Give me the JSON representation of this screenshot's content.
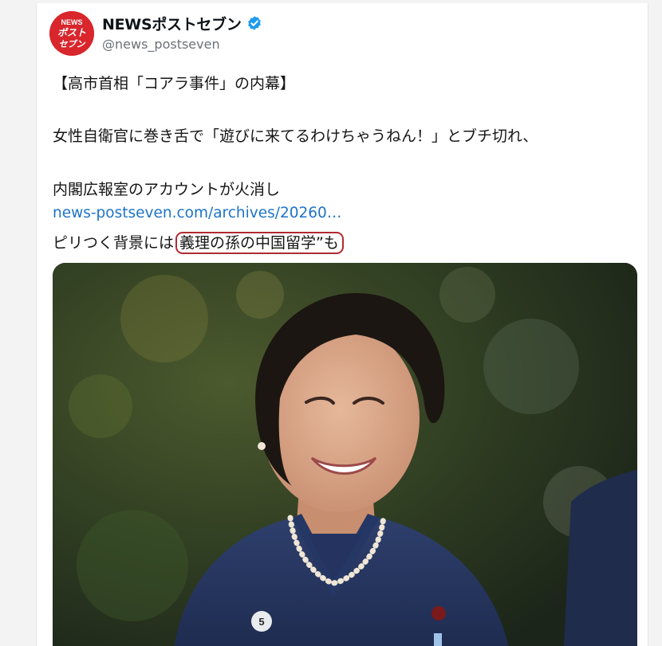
{
  "account": {
    "display_name": "NEWSポストセブン",
    "handle": "@news_postseven",
    "avatar_text_top": "NEWS",
    "avatar_text_mid": "ポスト",
    "avatar_text_bot": "セブン"
  },
  "tweet": {
    "line1": "【高市首相「コアラ事件」の内幕】",
    "line2": "女性自衛官に巻き舌で「遊びに来てるわけちゃうねん！」とブチ切れ、",
    "line3": "内閣広報室のアカウントが火消し",
    "link": "news-postseven.com/archives/20260…",
    "line5_prefix": "ピリつく背景には",
    "line5_circled": "義理の孫の中国留学”も"
  },
  "photo": {
    "pin_number": "5"
  },
  "colors": {
    "avatar_red": "#d8262c",
    "link_blue": "#1d74c7",
    "verified_blue": "#1d9bf0",
    "highlight_circle": "#b02a30"
  },
  "icons": [
    "verified-badge-icon"
  ]
}
